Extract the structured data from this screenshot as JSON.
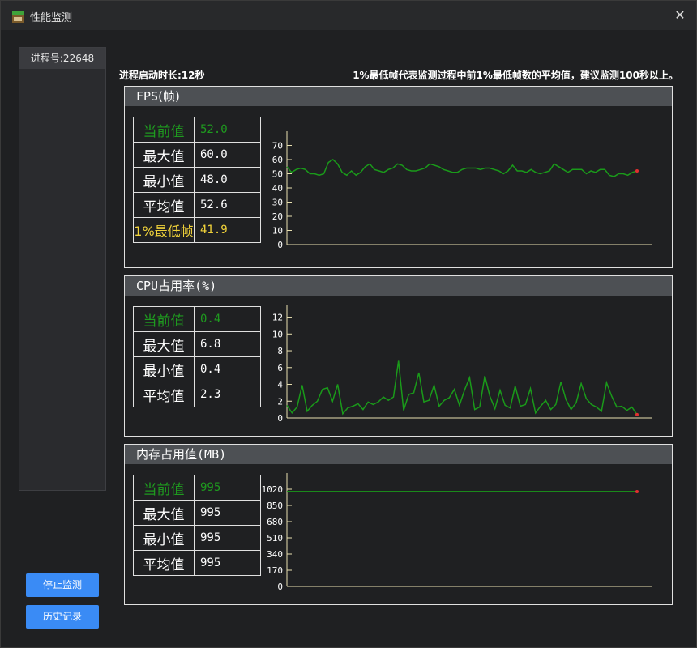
{
  "window": {
    "title": "性能监测",
    "close_glyph": "✕"
  },
  "sidebar": {
    "process_label": "进程号:22648"
  },
  "buttons": {
    "stop": "停止监测",
    "history": "历史记录"
  },
  "info": {
    "uptime": "进程启动时长:12秒",
    "note": "1%最低帧代表监测过程中前1%最低帧数的平均值，建议监测100秒以上。"
  },
  "fps": {
    "title_prefix": "FPS",
    "title_cn": "(帧)",
    "labels": {
      "current": "当前值",
      "max": "最大值",
      "min": "最小值",
      "avg": "平均值",
      "low1": "1%最低帧"
    },
    "values": {
      "current": "52.0",
      "max": "60.0",
      "min": "48.0",
      "avg": "52.6",
      "low1": "41.9"
    }
  },
  "cpu": {
    "title_prefix": "CPU",
    "title_cn": "占用率",
    "title_suffix": "(%)",
    "labels": {
      "current": "当前值",
      "max": "最大值",
      "min": "最小值",
      "avg": "平均值"
    },
    "values": {
      "current": "0.4",
      "max": "6.8",
      "min": "0.4",
      "avg": "2.3"
    }
  },
  "mem": {
    "title_cn": "内存占用值",
    "title_suffix": "(MB)",
    "labels": {
      "current": "当前值",
      "max": "最大值",
      "min": "最小值",
      "avg": "平均值"
    },
    "values": {
      "current": "995",
      "max": "995",
      "min": "995",
      "avg": "995"
    }
  },
  "colors": {
    "line": "#1a9a1a",
    "axis": "#e8e0b0",
    "last_point": "#e03030",
    "green_text": "#1f9a1f",
    "yellow_text": "#f0d23a",
    "button": "#3a8bf5"
  },
  "chart_data": [
    {
      "type": "line",
      "name": "fps",
      "yticks": [
        0,
        10,
        20,
        30,
        40,
        50,
        60,
        70
      ],
      "ylim": [
        0,
        80
      ],
      "values": [
        55,
        51,
        53,
        54,
        53,
        50,
        50,
        49,
        50,
        58,
        60,
        57,
        51,
        49,
        52,
        49,
        51,
        55,
        57,
        53,
        52,
        51,
        53,
        54,
        57,
        56,
        53,
        52,
        52,
        53,
        54,
        57,
        56,
        55,
        53,
        52,
        51,
        51,
        53,
        54,
        54,
        54,
        53,
        54,
        54,
        53,
        52,
        50,
        52,
        56,
        52,
        52,
        51,
        53,
        51,
        50,
        51,
        52,
        57,
        55,
        53,
        51,
        53,
        53,
        53,
        50,
        52,
        51,
        53,
        53,
        49,
        48,
        50,
        50,
        49,
        51,
        52
      ]
    },
    {
      "type": "line",
      "name": "cpu",
      "yticks": [
        0,
        2,
        4,
        6,
        8,
        10,
        12
      ],
      "ylim": [
        0,
        13.5
      ],
      "values": [
        1.5,
        0.6,
        1.3,
        3.9,
        0.8,
        1.5,
        2.0,
        3.4,
        3.6,
        2.0,
        4.0,
        0.5,
        1.2,
        1.4,
        1.7,
        1.0,
        1.9,
        1.6,
        1.9,
        2.5,
        2.1,
        2.5,
        6.8,
        0.9,
        2.8,
        3.0,
        5.4,
        1.9,
        2.1,
        3.9,
        1.4,
        2.1,
        2.4,
        3.4,
        1.5,
        3.3,
        4.8,
        1.0,
        1.3,
        5.0,
        2.6,
        1.1,
        3.3,
        1.5,
        1.2,
        3.8,
        1.4,
        1.6,
        3.5,
        0.6,
        1.4,
        2.1,
        1.0,
        1.6,
        4.3,
        2.2,
        1.0,
        1.8,
        4.1,
        2.3,
        1.6,
        1.3,
        0.8,
        4.2,
        2.6,
        1.3,
        1.4,
        0.9,
        1.3,
        0.4
      ]
    },
    {
      "type": "line",
      "name": "memory",
      "yticks": [
        0,
        170,
        340,
        510,
        680,
        850,
        1020
      ],
      "ylim": [
        0,
        1190
      ],
      "values": [
        995,
        995
      ]
    }
  ]
}
